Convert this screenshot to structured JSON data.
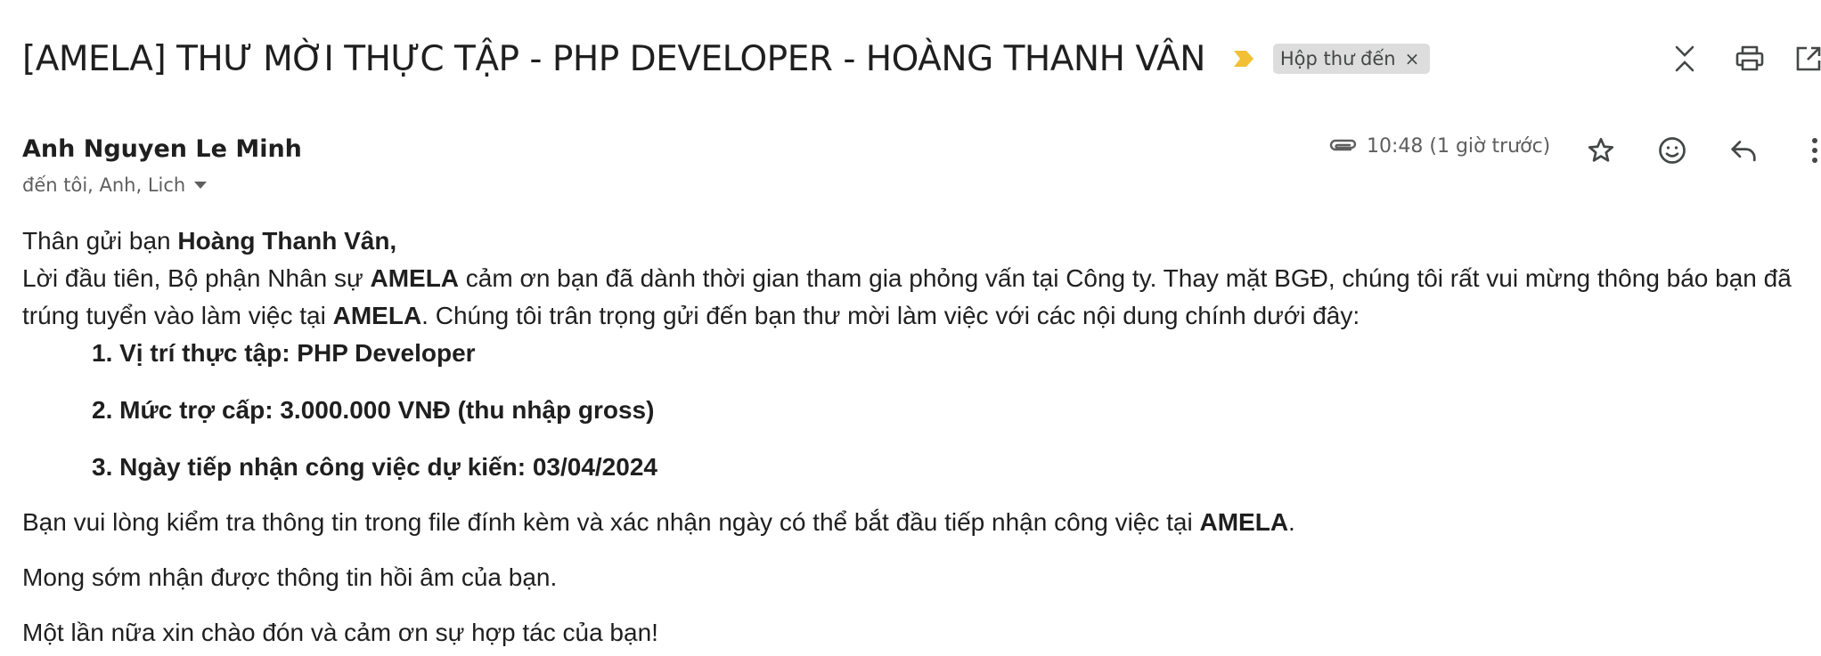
{
  "subject": "[AMELA] THƯ MỜI THỰC TẬP - PHP DEVELOPER - HOÀNG THANH VÂN",
  "label_chip": {
    "text": "Hộp thư đến",
    "remove": "×"
  },
  "sender": {
    "name": "Anh Nguyen Le Minh",
    "recipients": "đến tôi, Anh, Lich"
  },
  "meta": {
    "time": "10:48 (1 giờ trước)"
  },
  "icons": {
    "importance": "importance-marker-icon",
    "collapse": "collapse-all-icon",
    "print": "print-icon",
    "new_window": "open-in-new-window-icon",
    "attachment": "paperclip-icon",
    "star": "star-icon",
    "emoji": "emoji-reaction-icon",
    "reply": "reply-icon",
    "more": "more-vertical-icon",
    "caret": "dropdown-caret-icon"
  },
  "colors": {
    "importance": "#f2c035",
    "chip_bg": "#dddddd",
    "icon": "#444746"
  },
  "body": {
    "greeting_prefix": "Thân gửi bạn ",
    "greeting_name": "Hoàng Thanh Vân,",
    "para1_a": "Lời đầu tiên, Bộ phận Nhân sự ",
    "company": "AMELA",
    "para1_b": " cảm ơn bạn đã dành thời gian tham gia phỏng vấn tại Công ty. Thay mặt BGĐ, chúng tôi rất vui mừng thông báo bạn đã trúng tuyển vào làm việc tại ",
    "para1_c": ". Chúng tôi trân trọng gửi đến bạn thư mời làm việc với các nội dung chính dưới đây:",
    "list": [
      "1. Vị trí thực tập: PHP Developer",
      "2. Mức trợ cấp: 3.000.000 VNĐ (thu nhập gross)",
      "3. Ngày tiếp nhận công việc dự kiến: 03/04/2024"
    ],
    "para2_a": "Bạn vui lòng kiểm tra thông tin trong file đính kèm và xác nhận ngày có thể bắt đầu tiếp nhận công việc tại ",
    "para2_b": ".",
    "para3": "Mong sớm nhận được thông tin hồi âm của bạn.",
    "para4": "Một lần nữa xin chào đón và cảm ơn sự hợp tác của bạn!"
  }
}
